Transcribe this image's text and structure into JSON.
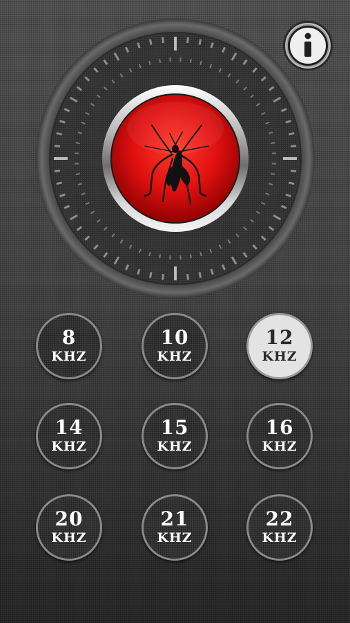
{
  "info_button": {
    "icon": "info-icon",
    "glyph": "i"
  },
  "repeller_button": {
    "icon": "mosquito-icon",
    "color": "#e01010"
  },
  "frequencies": [
    {
      "value": "8",
      "unit": "KHZ",
      "active": false
    },
    {
      "value": "10",
      "unit": "KHZ",
      "active": false
    },
    {
      "value": "12",
      "unit": "KHZ",
      "active": true
    },
    {
      "value": "14",
      "unit": "KHZ",
      "active": false
    },
    {
      "value": "15",
      "unit": "KHZ",
      "active": false
    },
    {
      "value": "16",
      "unit": "KHZ",
      "active": false
    },
    {
      "value": "20",
      "unit": "KHZ",
      "active": false
    },
    {
      "value": "21",
      "unit": "KHZ",
      "active": false
    },
    {
      "value": "22",
      "unit": "KHZ",
      "active": false
    }
  ]
}
